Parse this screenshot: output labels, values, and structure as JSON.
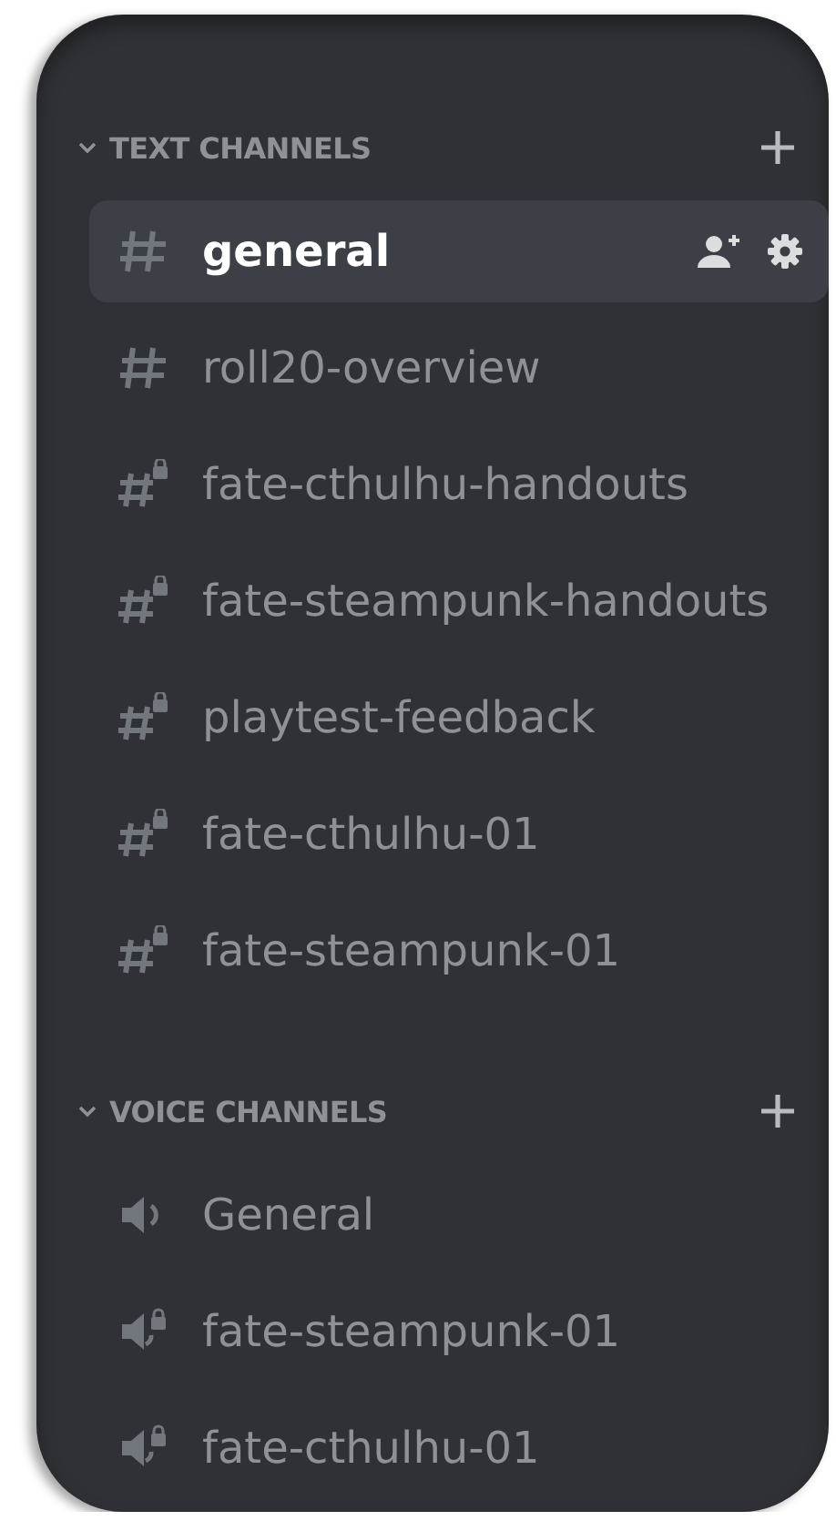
{
  "categories": [
    {
      "title": "TEXT CHANNELS",
      "expanded": true,
      "channels": [
        {
          "name": "general",
          "kind": "text",
          "selected": true
        },
        {
          "name": "roll20-overview",
          "kind": "text",
          "selected": false
        },
        {
          "name": "fate-cthulhu-handouts",
          "kind": "text-locked",
          "selected": false
        },
        {
          "name": "fate-steampunk-handouts",
          "kind": "text-locked",
          "selected": false
        },
        {
          "name": "playtest-feedback",
          "kind": "text-locked",
          "selected": false
        },
        {
          "name": "fate-cthulhu-01",
          "kind": "text-locked",
          "selected": false
        },
        {
          "name": "fate-steampunk-01",
          "kind": "text-locked",
          "selected": false
        }
      ]
    },
    {
      "title": "VOICE CHANNELS",
      "expanded": true,
      "channels": [
        {
          "name": "General",
          "kind": "voice",
          "selected": false
        },
        {
          "name": "fate-steampunk-01",
          "kind": "voice-locked",
          "selected": false
        },
        {
          "name": "fate-cthulhu-01",
          "kind": "voice-locked",
          "selected": false
        }
      ]
    }
  ]
}
